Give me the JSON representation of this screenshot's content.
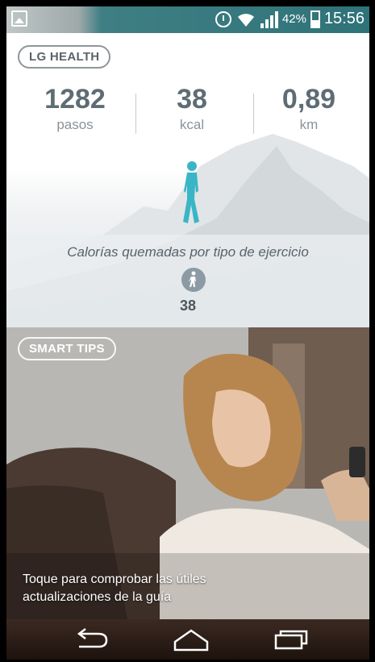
{
  "status_bar": {
    "battery_percent": "42%",
    "time": "15:56",
    "icons": [
      "image-notification-icon",
      "alarm-icon",
      "wifi-icon",
      "signal-icon",
      "battery-icon"
    ]
  },
  "health": {
    "badge": "LG HEALTH",
    "stats": [
      {
        "value": "1282",
        "unit": "pasos"
      },
      {
        "value": "38",
        "unit": "kcal"
      },
      {
        "value": "0,89",
        "unit": "km"
      }
    ],
    "calories_title": "Calorías quemadas por tipo de ejercicio",
    "calories_value": "38",
    "accent_color": "#39b6c6"
  },
  "smart_tips": {
    "badge": "SMART TIPS",
    "text_line1": "Toque para comprobar las útiles",
    "text_line2": "actualizaciones de la guía"
  },
  "nav_bar": {
    "buttons": [
      "back-icon",
      "home-icon",
      "recents-icon"
    ]
  }
}
